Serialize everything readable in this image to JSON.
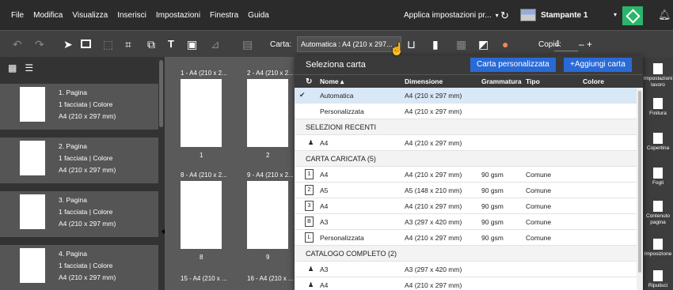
{
  "menubar": {
    "items": [
      "File",
      "Modifica",
      "Visualizza",
      "Inserisci",
      "Impostazioni",
      "Finestra",
      "Guida"
    ],
    "apply_settings": "Applica impostazioni pr...",
    "printer": "Stampante 1"
  },
  "toolbar": {
    "carta_label": "Carta:",
    "carta_value": "Automatica : A4 (210 x 297...",
    "copie_label": "Copie:",
    "copie_value": "1"
  },
  "pages": [
    {
      "title": "1. Pagina",
      "sides": "1 facciata | Colore",
      "size": "A4 (210 x 297 mm)"
    },
    {
      "title": "2. Pagina",
      "sides": "1 facciata | Colore",
      "size": "A4 (210 x 297 mm)"
    },
    {
      "title": "3. Pagina",
      "sides": "1 facciata | Colore",
      "size": "A4 (210 x 297 mm)"
    },
    {
      "title": "4. Pagina",
      "sides": "1 facciata | Colore",
      "size": "A4 (210 x 297 mm)"
    }
  ],
  "grid": {
    "labels": [
      "1 - A4 (210 x 2...",
      "2 - A4 (210 x 2...",
      "8 - A4 (210 x 2...",
      "9 - A4 (210 x 2...",
      "15 - A4 (210 x ...",
      "16 - A4 (210 x ..."
    ],
    "numbers": [
      "1",
      "2",
      "8",
      "9"
    ]
  },
  "popup": {
    "title": "Seleziona carta",
    "custom_btn": "Carta personalizzata",
    "add_btn": "+Aggiungi carta",
    "columns": {
      "name": "Nome ▴",
      "size": "Dimensione",
      "weight": "Grammatura",
      "type": "Tipo",
      "color": "Colore"
    },
    "rows": [
      {
        "kind": "item",
        "icon": "check",
        "name": "Automatica",
        "size": "A4 (210 x 297 mm)",
        "weight": "",
        "type": "",
        "selected": true
      },
      {
        "kind": "item",
        "icon": "",
        "name": "Personalizzata",
        "size": "A4 (210 x 297 mm)",
        "weight": "",
        "type": ""
      },
      {
        "kind": "section",
        "name": "SELEZIONI RECENTI"
      },
      {
        "kind": "item",
        "icon": "person",
        "name": "A4",
        "size": "A4 (210 x 297 mm)",
        "weight": "",
        "type": ""
      },
      {
        "kind": "section",
        "name": "CARTA CARICATA (5)"
      },
      {
        "kind": "item",
        "icon": "tray",
        "tray": "1",
        "name": "A4",
        "size": "A4 (210 x 297 mm)",
        "weight": "90 gsm",
        "type": "Comune"
      },
      {
        "kind": "item",
        "icon": "tray",
        "tray": "2",
        "name": "A5",
        "size": "A5 (148 x 210 mm)",
        "weight": "90 gsm",
        "type": "Comune"
      },
      {
        "kind": "item",
        "icon": "tray",
        "tray": "3",
        "name": "A4",
        "size": "A4 (210 x 297 mm)",
        "weight": "90 gsm",
        "type": "Comune"
      },
      {
        "kind": "item",
        "icon": "tray",
        "tray": "B",
        "name": "A3",
        "size": "A3 (297 x 420 mm)",
        "weight": "90 gsm",
        "type": "Comune"
      },
      {
        "kind": "item",
        "icon": "tray",
        "tray": "L",
        "name": "Personalizzata",
        "size": "A4 (210 x 297 mm)",
        "weight": "90 gsm",
        "type": "Comune"
      },
      {
        "kind": "section",
        "name": "CATALOGO COMPLETO (2)"
      },
      {
        "kind": "item",
        "icon": "person",
        "name": "A3",
        "size": "A3 (297 x 420 mm)",
        "weight": "",
        "type": ""
      },
      {
        "kind": "item",
        "icon": "person",
        "name": "A4",
        "size": "A4 (210 x 297 mm)",
        "weight": "",
        "type": ""
      }
    ]
  },
  "rightbar": [
    "Impostazioni lavoro",
    "Finitura",
    "Copertina",
    "Fogli",
    "Contenuto pagina",
    "Imposizione",
    "Ripulisci"
  ]
}
